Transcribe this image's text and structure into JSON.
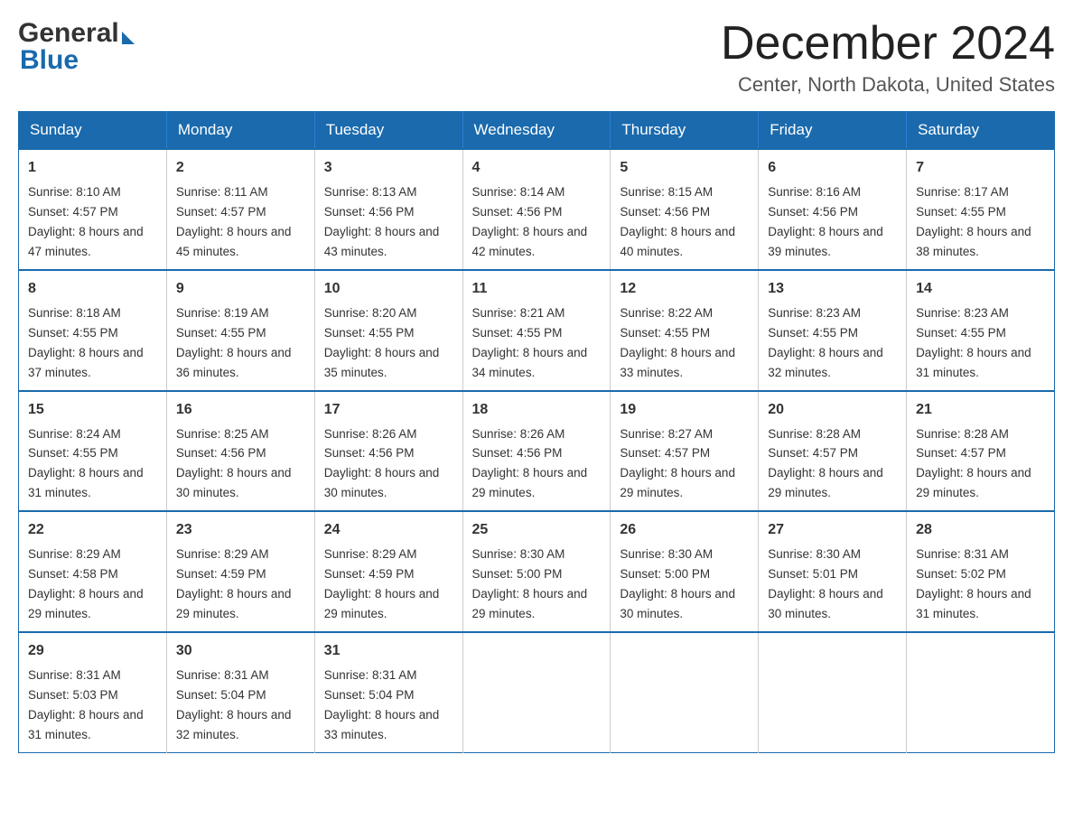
{
  "header": {
    "logo_text_general": "General",
    "logo_text_blue": "Blue",
    "month_title": "December 2024",
    "location": "Center, North Dakota, United States"
  },
  "weekdays": [
    "Sunday",
    "Monday",
    "Tuesday",
    "Wednesday",
    "Thursday",
    "Friday",
    "Saturday"
  ],
  "weeks": [
    [
      {
        "day": "1",
        "sunrise": "8:10 AM",
        "sunset": "4:57 PM",
        "daylight": "8 hours and 47 minutes."
      },
      {
        "day": "2",
        "sunrise": "8:11 AM",
        "sunset": "4:57 PM",
        "daylight": "8 hours and 45 minutes."
      },
      {
        "day": "3",
        "sunrise": "8:13 AM",
        "sunset": "4:56 PM",
        "daylight": "8 hours and 43 minutes."
      },
      {
        "day": "4",
        "sunrise": "8:14 AM",
        "sunset": "4:56 PM",
        "daylight": "8 hours and 42 minutes."
      },
      {
        "day": "5",
        "sunrise": "8:15 AM",
        "sunset": "4:56 PM",
        "daylight": "8 hours and 40 minutes."
      },
      {
        "day": "6",
        "sunrise": "8:16 AM",
        "sunset": "4:56 PM",
        "daylight": "8 hours and 39 minutes."
      },
      {
        "day": "7",
        "sunrise": "8:17 AM",
        "sunset": "4:55 PM",
        "daylight": "8 hours and 38 minutes."
      }
    ],
    [
      {
        "day": "8",
        "sunrise": "8:18 AM",
        "sunset": "4:55 PM",
        "daylight": "8 hours and 37 minutes."
      },
      {
        "day": "9",
        "sunrise": "8:19 AM",
        "sunset": "4:55 PM",
        "daylight": "8 hours and 36 minutes."
      },
      {
        "day": "10",
        "sunrise": "8:20 AM",
        "sunset": "4:55 PM",
        "daylight": "8 hours and 35 minutes."
      },
      {
        "day": "11",
        "sunrise": "8:21 AM",
        "sunset": "4:55 PM",
        "daylight": "8 hours and 34 minutes."
      },
      {
        "day": "12",
        "sunrise": "8:22 AM",
        "sunset": "4:55 PM",
        "daylight": "8 hours and 33 minutes."
      },
      {
        "day": "13",
        "sunrise": "8:23 AM",
        "sunset": "4:55 PM",
        "daylight": "8 hours and 32 minutes."
      },
      {
        "day": "14",
        "sunrise": "8:23 AM",
        "sunset": "4:55 PM",
        "daylight": "8 hours and 31 minutes."
      }
    ],
    [
      {
        "day": "15",
        "sunrise": "8:24 AM",
        "sunset": "4:55 PM",
        "daylight": "8 hours and 31 minutes."
      },
      {
        "day": "16",
        "sunrise": "8:25 AM",
        "sunset": "4:56 PM",
        "daylight": "8 hours and 30 minutes."
      },
      {
        "day": "17",
        "sunrise": "8:26 AM",
        "sunset": "4:56 PM",
        "daylight": "8 hours and 30 minutes."
      },
      {
        "day": "18",
        "sunrise": "8:26 AM",
        "sunset": "4:56 PM",
        "daylight": "8 hours and 29 minutes."
      },
      {
        "day": "19",
        "sunrise": "8:27 AM",
        "sunset": "4:57 PM",
        "daylight": "8 hours and 29 minutes."
      },
      {
        "day": "20",
        "sunrise": "8:28 AM",
        "sunset": "4:57 PM",
        "daylight": "8 hours and 29 minutes."
      },
      {
        "day": "21",
        "sunrise": "8:28 AM",
        "sunset": "4:57 PM",
        "daylight": "8 hours and 29 minutes."
      }
    ],
    [
      {
        "day": "22",
        "sunrise": "8:29 AM",
        "sunset": "4:58 PM",
        "daylight": "8 hours and 29 minutes."
      },
      {
        "day": "23",
        "sunrise": "8:29 AM",
        "sunset": "4:59 PM",
        "daylight": "8 hours and 29 minutes."
      },
      {
        "day": "24",
        "sunrise": "8:29 AM",
        "sunset": "4:59 PM",
        "daylight": "8 hours and 29 minutes."
      },
      {
        "day": "25",
        "sunrise": "8:30 AM",
        "sunset": "5:00 PM",
        "daylight": "8 hours and 29 minutes."
      },
      {
        "day": "26",
        "sunrise": "8:30 AM",
        "sunset": "5:00 PM",
        "daylight": "8 hours and 30 minutes."
      },
      {
        "day": "27",
        "sunrise": "8:30 AM",
        "sunset": "5:01 PM",
        "daylight": "8 hours and 30 minutes."
      },
      {
        "day": "28",
        "sunrise": "8:31 AM",
        "sunset": "5:02 PM",
        "daylight": "8 hours and 31 minutes."
      }
    ],
    [
      {
        "day": "29",
        "sunrise": "8:31 AM",
        "sunset": "5:03 PM",
        "daylight": "8 hours and 31 minutes."
      },
      {
        "day": "30",
        "sunrise": "8:31 AM",
        "sunset": "5:04 PM",
        "daylight": "8 hours and 32 minutes."
      },
      {
        "day": "31",
        "sunrise": "8:31 AM",
        "sunset": "5:04 PM",
        "daylight": "8 hours and 33 minutes."
      },
      null,
      null,
      null,
      null
    ]
  ],
  "labels": {
    "sunrise_prefix": "Sunrise: ",
    "sunset_prefix": "Sunset: ",
    "daylight_prefix": "Daylight: "
  }
}
